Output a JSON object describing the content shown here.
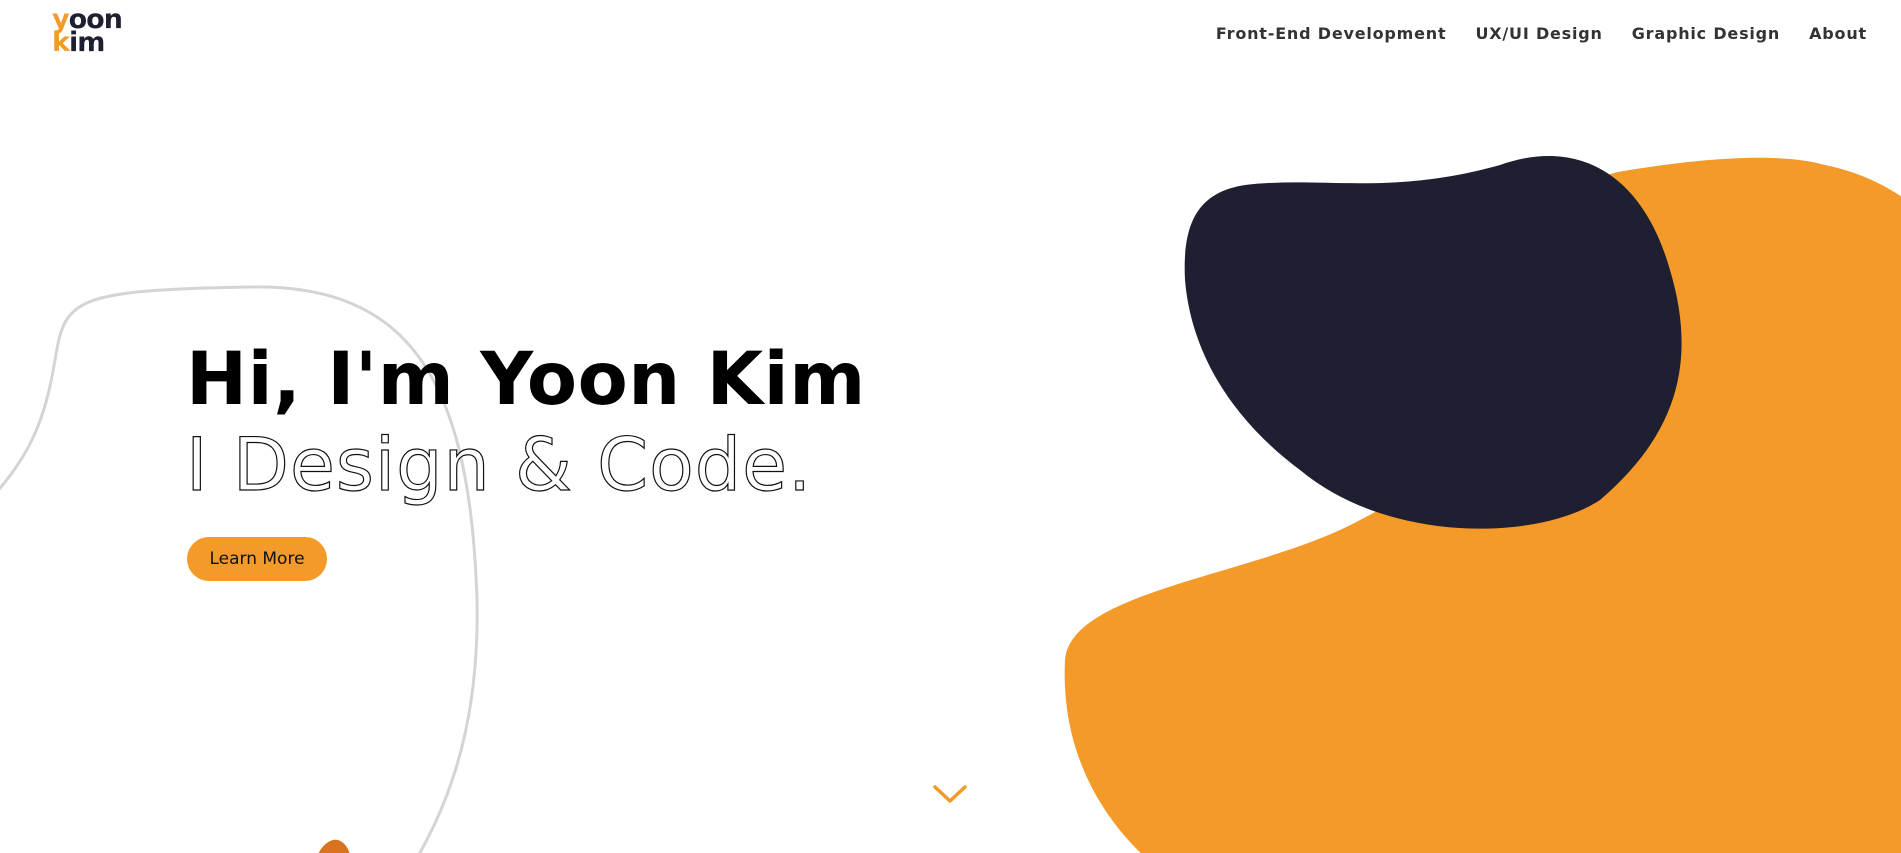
{
  "logo": {
    "line1_accent": "y",
    "line1_rest": "oon",
    "line2_accent": "k",
    "line2_rest": "im"
  },
  "nav": {
    "items": [
      {
        "label": "Front-End Development"
      },
      {
        "label": "UX/UI Design"
      },
      {
        "label": "Graphic Design"
      },
      {
        "label": "About"
      }
    ]
  },
  "hero": {
    "title": "Hi, I'm Yoon Kim",
    "subtitle": "I Design & Code.",
    "cta_label": "Learn More"
  },
  "scroll": {
    "icon": "chevron-down-icon"
  },
  "colors": {
    "accent": "#f39a28",
    "dark_blob": "#1e1f30",
    "outline_blob": "#d4d4d4",
    "text": "#000000",
    "nav_text": "#333333"
  }
}
